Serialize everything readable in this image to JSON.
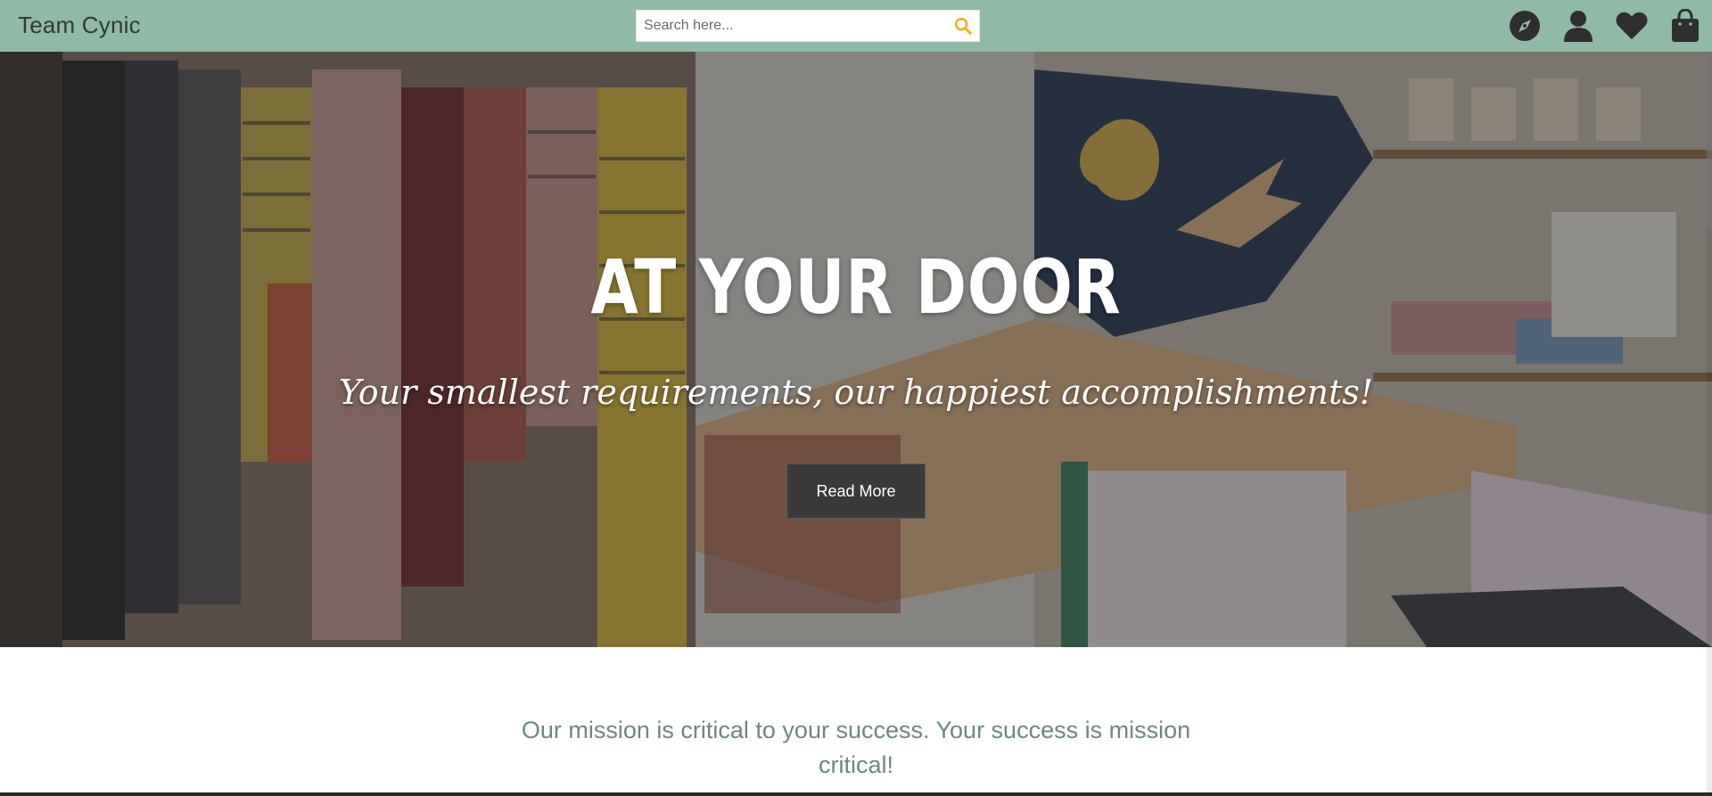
{
  "navbar": {
    "brand": "Team Cynic",
    "search": {
      "placeholder": "Search here...",
      "value": "",
      "icon": "search-icon"
    },
    "icons": [
      "compass-icon",
      "user-icon",
      "heart-icon",
      "shopping-bag-icon"
    ]
  },
  "hero": {
    "title": "AT YOUR DOOR",
    "tagline": "Your smallest requirements, our happiest accomplishments!",
    "button_label": "Read More"
  },
  "mission": {
    "text": "Our mission is critical to your success. Your success is mission critical!"
  },
  "colors": {
    "navbar_bg": "#8fbaa6",
    "search_icon": "#f0b429",
    "icon_color": "#2f2f2f",
    "mission_text": "#6a8a78",
    "button_bg": "#3a3a3a"
  }
}
